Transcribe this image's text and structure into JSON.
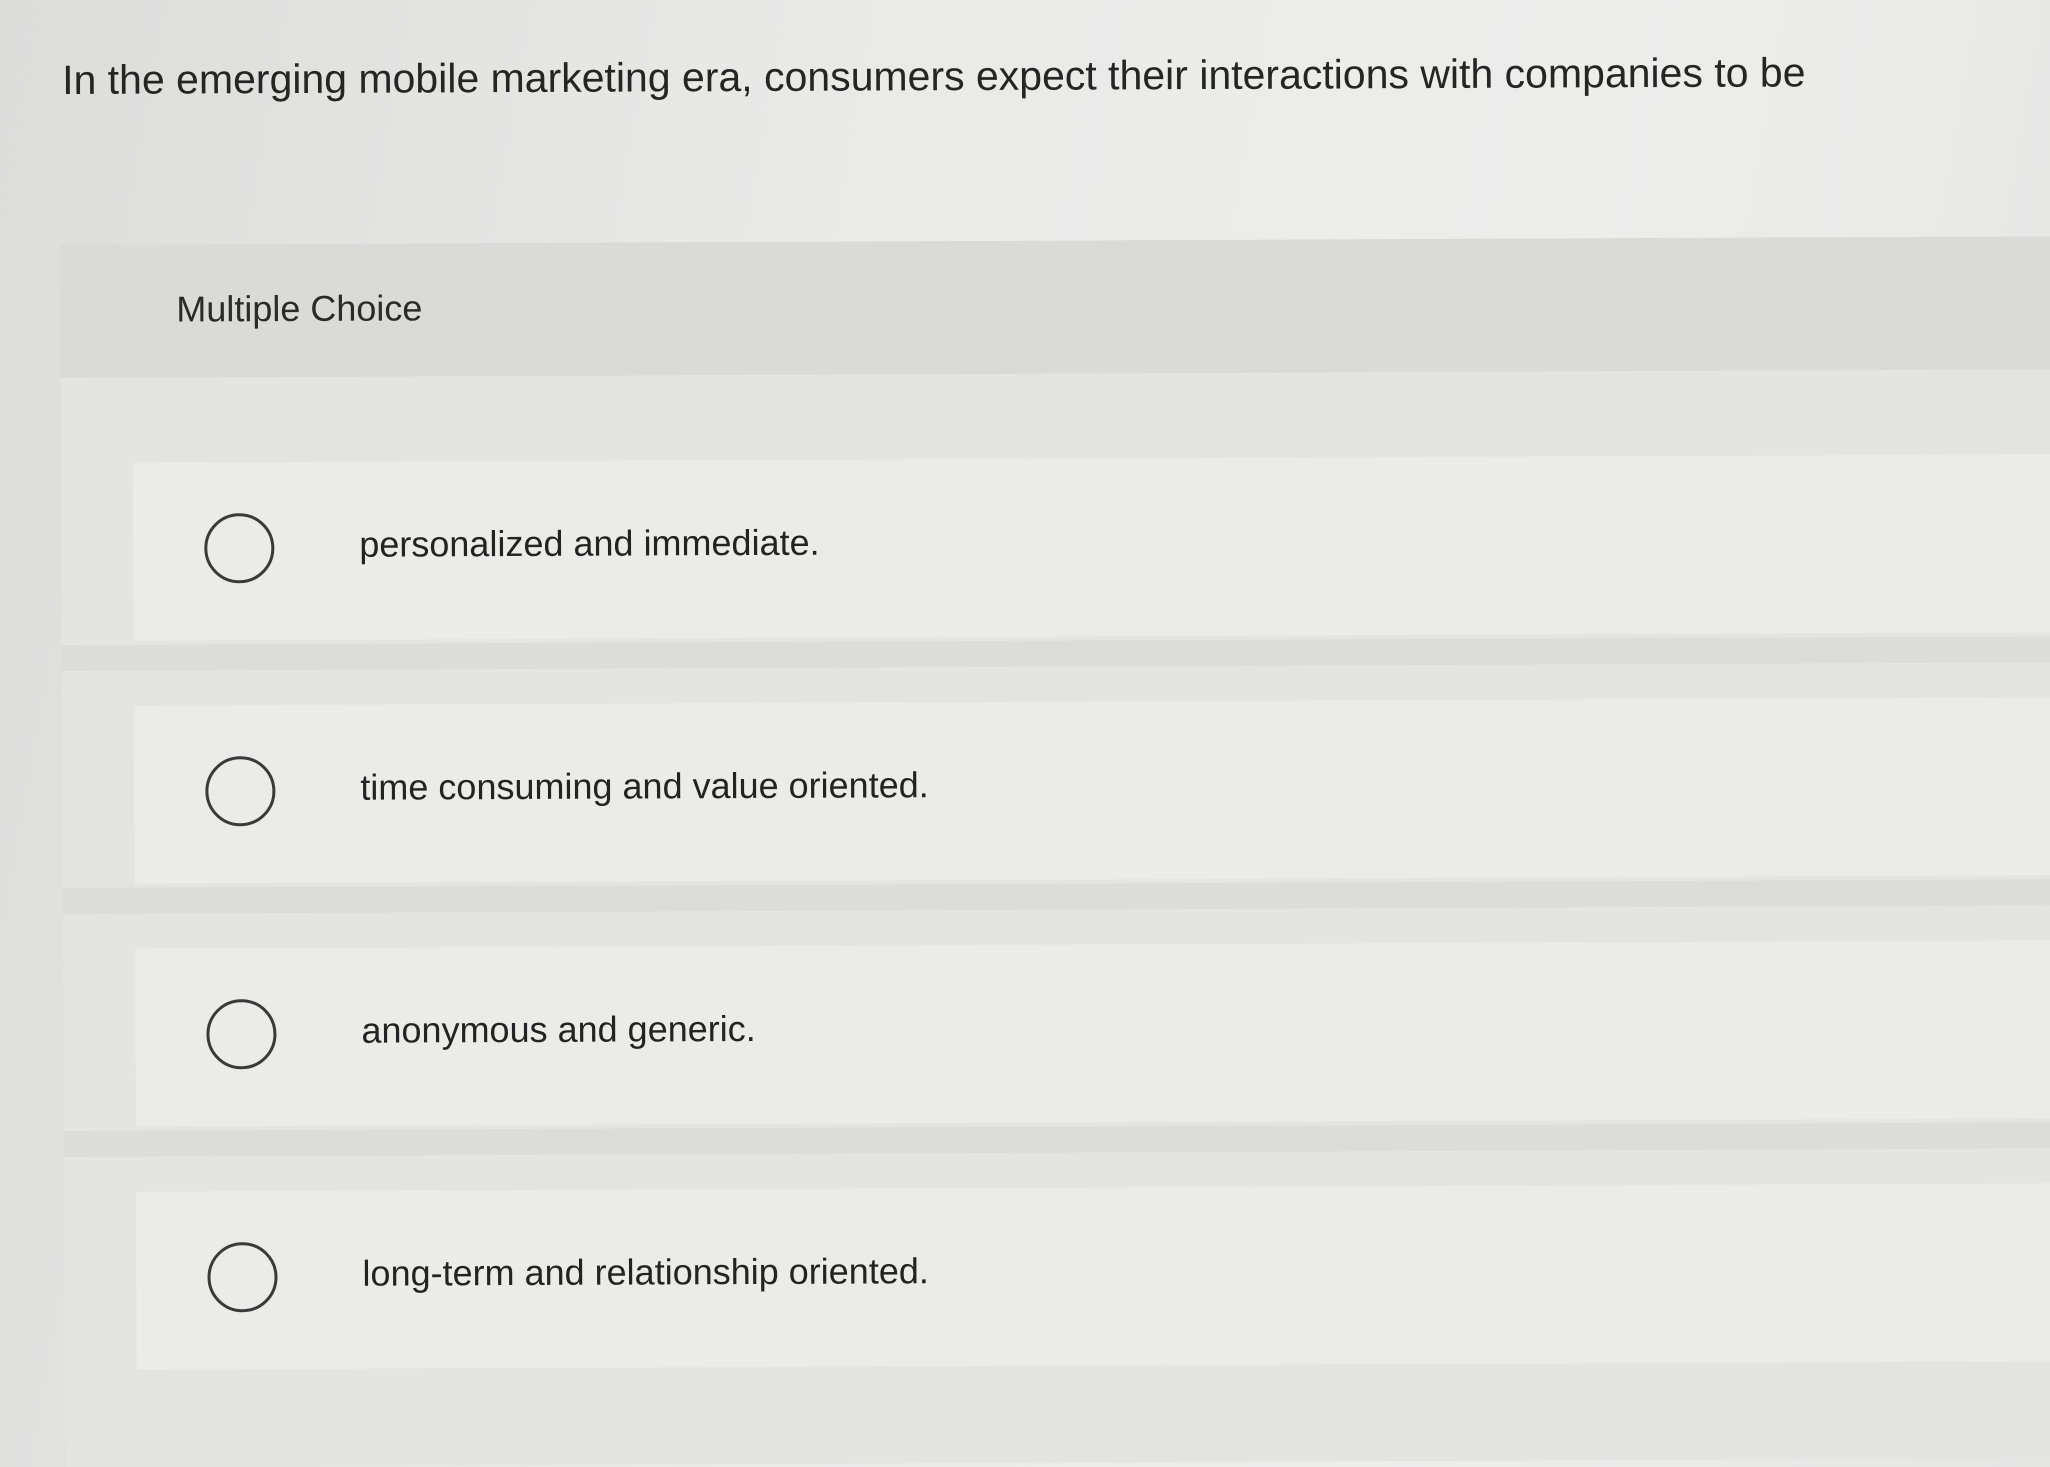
{
  "question": {
    "text": "In the emerging mobile marketing era, consumers expect their interactions with companies to be"
  },
  "card": {
    "label": "Multiple Choice",
    "options": [
      {
        "label": "personalized and immediate.",
        "selected": false
      },
      {
        "label": "time consuming and value oriented.",
        "selected": false
      },
      {
        "label": "anonymous and generic.",
        "selected": false
      },
      {
        "label": "long-term and relationship oriented.",
        "selected": false
      }
    ]
  },
  "colors": {
    "background": "#e6e6e5",
    "header": "#dadad9",
    "option": "#ebebea",
    "text": "#232323",
    "radio_border": "#3a3a3a"
  }
}
